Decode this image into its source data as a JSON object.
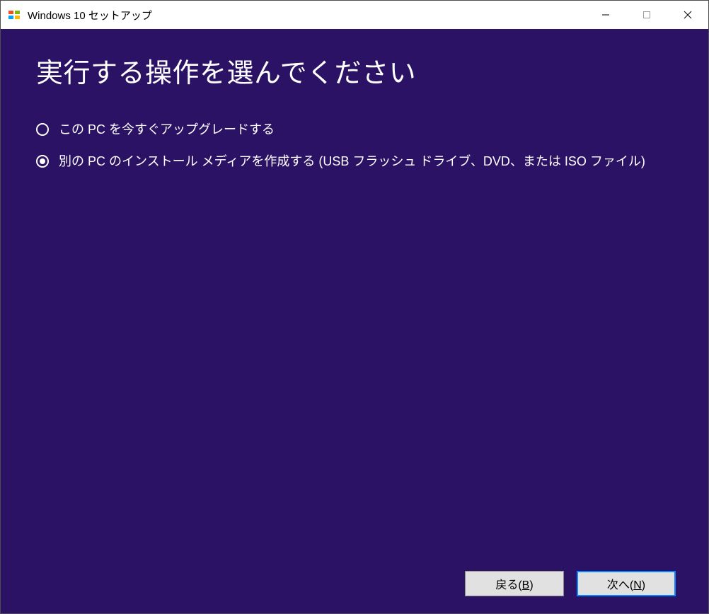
{
  "titlebar": {
    "title": "Windows 10 セットアップ"
  },
  "main": {
    "heading": "実行する操作を選んでください",
    "options": [
      {
        "label": "この PC を今すぐアップグレードする",
        "selected": false
      },
      {
        "label": "別の PC のインストール メディアを作成する (USB フラッシュ ドライブ、DVD、または ISO ファイル)",
        "selected": true
      }
    ]
  },
  "buttons": {
    "back_prefix": "戻る(",
    "back_key": "B",
    "back_suffix": ")",
    "next_prefix": "次へ(",
    "next_key": "N",
    "next_suffix": ")"
  }
}
